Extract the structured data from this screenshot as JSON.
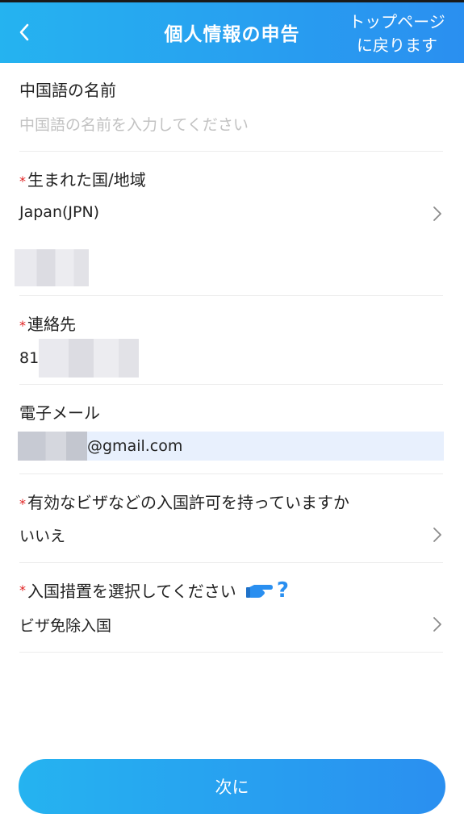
{
  "header": {
    "title": "個人情報の申告",
    "home_line1": "トップページ",
    "home_line2": "に戻ります"
  },
  "form": {
    "chinese_name": {
      "label": "中国語の名前",
      "placeholder": "中国語の名前を入力してください"
    },
    "birth_country": {
      "required": "*",
      "label": "生まれた国/地域",
      "value": "Japan(JPN)"
    },
    "contact": {
      "required": "*",
      "label": "連絡先",
      "prefix": "81"
    },
    "email": {
      "label": "電子メール",
      "domain": "@gmail.com"
    },
    "visa": {
      "required": "*",
      "label": "有効なビザなどの入国許可を持っていますか",
      "value": "いいえ"
    },
    "entry_measure": {
      "required": "*",
      "label": "入国措置を選択してください",
      "help": "?",
      "value": "ビザ免除入国"
    }
  },
  "footer": {
    "next_label": "次に"
  },
  "colors": {
    "accent_start": "#25b3f0",
    "accent_end": "#2a8ff0",
    "required": "#e02020"
  }
}
